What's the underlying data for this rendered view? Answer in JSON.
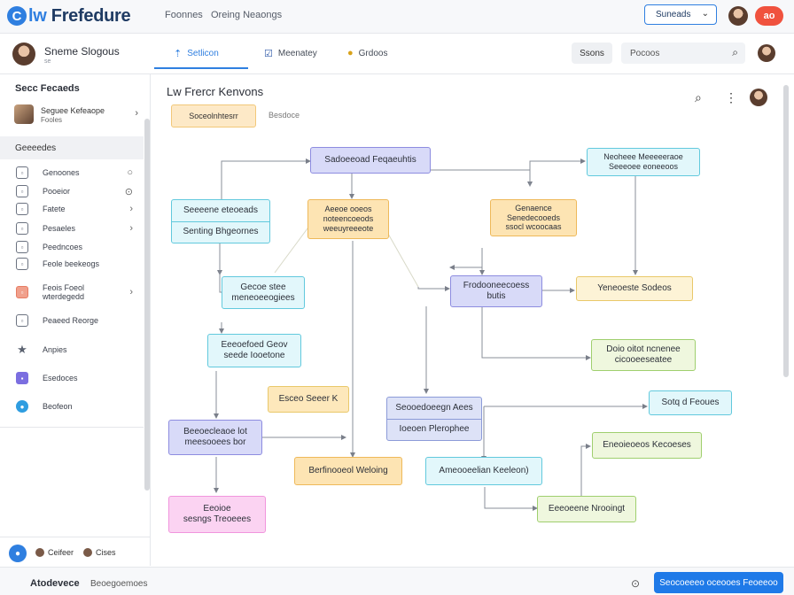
{
  "app": {
    "logo_letter": "C",
    "logo_text_a": "lw ",
    "logo_text_b": "Frefedure",
    "nav": [
      "Foonnes",
      "Oreing Neaongs"
    ],
    "select_value": "Suneads",
    "select_icon": "chevron-down-icon",
    "pill_label": "ao"
  },
  "header": {
    "user_name": "Sneme Slogous",
    "user_sub": "se",
    "tabs": [
      {
        "label": "Setlicon",
        "icon": "pin-icon"
      },
      {
        "label": "Meenatey",
        "icon": "checkbox-icon"
      },
      {
        "label": "Grdoos",
        "icon": "coin-icon"
      }
    ],
    "button_label": "Ssons",
    "search_placeholder": "Pocoos"
  },
  "sidebar": {
    "title": "Secc Fecaeds",
    "card": {
      "line1": "Seguee Kefeaope",
      "line2": "Fooles"
    },
    "section": "Geeeedes",
    "items": [
      {
        "label": "Genoones",
        "icon": "box-icon",
        "chevron": "○"
      },
      {
        "label": "Pooeior",
        "icon": "box-icon",
        "chevron": "⊙"
      },
      {
        "label": "Fatete",
        "icon": "box-icon",
        "chevron": "›"
      },
      {
        "label": "Pesaeles",
        "icon": "box-icon",
        "chevron": "›"
      },
      {
        "label": "Peedncoes",
        "icon": "box-icon",
        "chevron": ""
      },
      {
        "label": "Feole beekeogs",
        "icon": "box-icon",
        "chevron": ""
      },
      {
        "label": "Feois Foeol wterdegedd",
        "icon": "box-icon",
        "chevron": "›"
      },
      {
        "label": "Peaeed Reorge",
        "icon": "box-icon",
        "chevron": ""
      }
    ],
    "items2": [
      {
        "label": "Anpies",
        "icon": "star-icon"
      },
      {
        "label": "Esedoces",
        "icon": "square-icon"
      },
      {
        "label": "Beofeon",
        "icon": "chat-icon"
      }
    ],
    "footer": {
      "btn": "●",
      "item1": "Ceifeer",
      "item2": "Cises"
    }
  },
  "canvas": {
    "title": "Lw Frercr Kenvons",
    "chip": "Soceolnhtesrr",
    "chip2": "Besdoce",
    "tools": [
      "⌕",
      "⋮"
    ],
    "nodes": {
      "n_top": "Sadoeeoad Feqaeuhtis",
      "n_left1_a": "Seeeene eteoeads",
      "n_left1_b": "Senting Bhgeornes",
      "n_mid_yellow": "Aeeoe ooeos\nnoteencoeods\nweeuyreeeote",
      "n_right_yellow": "Genaence\nSenedecooeds\nssocl wcoocaas",
      "n_right_cyan": "Neoheee Meeeeeraoe\nSeeeoee eoneeoos",
      "n_center_purple": "Frodooneecoess\nbutis",
      "n_right_lightyellow": "Yeneoeste Sodeos",
      "n_cyan2": "Gecoe stee\nmeneoeeogiees",
      "n_cyan3": "Eeeoefoed Geov\nseede Iooetone",
      "n_lime1": "Doio oitot ncnenee\ncicooeeseatee",
      "n_yellow_small": "Esceo Seeer K",
      "n_lav_a": "Seooedoeegn Aees",
      "n_lav_b": "Ioeoen Plerophee",
      "n_cyan_small": "Sotq d Feoues",
      "n_purple_bottom": "Beeoecleaoe lot\nmeesooees bor",
      "n_yellow_bottom": "Berfinooeol Weloing",
      "n_cyan_bottom": "Ameooeelian Keeleon)",
      "n_lime2": "Eneoieoeos Kecoeses",
      "n_lime3": "Eeeoeene Nrooingt",
      "n_pink": "Eeoioe\nsesngs Treoeees"
    }
  },
  "bottombar": {
    "title": "Atodevece",
    "sub": "Beoegoemoes",
    "icon": "⊙",
    "button": "Seocoeeeo oceooes Feoeeoo"
  }
}
